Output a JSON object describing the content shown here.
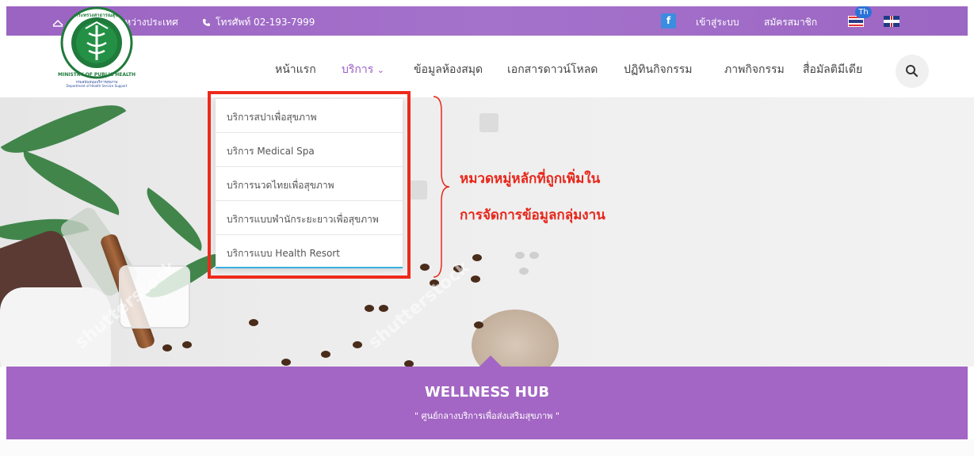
{
  "topbar": {
    "org_icon": "home-outline-icon",
    "org_label": "กองสุขภาพระหว่างประเทศ",
    "phone_icon": "phone-icon",
    "phone_label": "โทรศัพท์ 02-193-7999",
    "facebook_icon": "facebook-icon",
    "facebook_glyph": "f",
    "login_label": "เข้าสู่ระบบ",
    "register_label": "สมัครสมาชิก",
    "lang_th_badge": "Th",
    "colors": {
      "bar": "#a06ac8",
      "facebook": "#3b8de0"
    }
  },
  "logo": {
    "top_text": "กระทรวงสาธารณสุข",
    "ring_text": "MINISTRY OF PUBLIC HEALTH",
    "dept_th": "กรมสนับสนุนบริการสุขภาพ",
    "dept_en": "Department of Health Service Support"
  },
  "nav": {
    "items": [
      {
        "label": "หน้าแรก"
      },
      {
        "label": "บริการ"
      },
      {
        "label": "ข้อมูลห้องสมุด"
      },
      {
        "label": "เอกสารดาวน์โหลด"
      },
      {
        "label": "ปฏิทินกิจกรรม"
      },
      {
        "label": "ภาพกิจกรรม"
      },
      {
        "label": "สื่อมัลติมีเดีย"
      }
    ],
    "active_color": "#9b5bc8",
    "search_icon": "search-icon"
  },
  "dropdown": {
    "items": [
      {
        "label": "บริการสปาเพื่อสุขภาพ"
      },
      {
        "label": "บริการ Medical Spa"
      },
      {
        "label": "บริการนวดไทยเพื่อสุขภาพ"
      },
      {
        "label": "บริการแบบพำนักระยะยาวเพื่อสุขภาพ"
      },
      {
        "label": "บริการแบบ Health Resort"
      }
    ]
  },
  "annotation": {
    "line1": "หมวดหมู่หลักที่ถูกเพิ่มใน",
    "line2": "การจัดการข้อมูลกลุ่มงาน",
    "color": "#e8261a"
  },
  "hero": {
    "watermark": "shutterstock"
  },
  "band": {
    "title": "WELLNESS HUB",
    "subtitle": "\" ศูนย์กลางบริการเพื่อส่งเสริมสุขภาพ \"",
    "color": "#a366c4"
  }
}
